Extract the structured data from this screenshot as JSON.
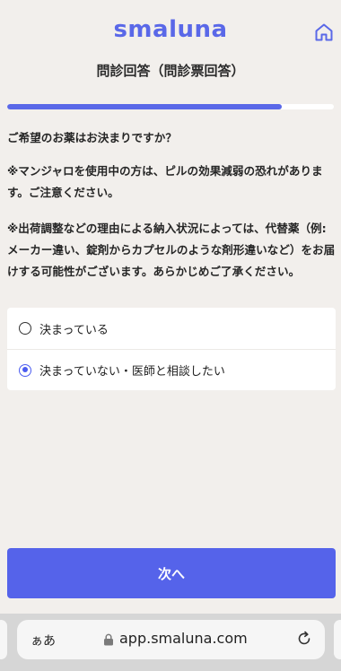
{
  "header": {
    "logo_text": "smaluna",
    "home_icon": "home-icon"
  },
  "page": {
    "title": "問診回答（問診票回答）"
  },
  "progress": {
    "fraction": 0.84
  },
  "question": {
    "text": "ご希望のお薬はお決まりですか？",
    "note1": "※マンジャロを使用中の方は、ピルの効果減弱の恐れがあります。ご注意ください。",
    "note2": "※出荷調整などの理由による納入状況によっては、代替薬（例:メーカー違い、錠剤からカプセルのような剤形違いなど）をお届けする可能性がございます。あらかじめご了承ください。"
  },
  "options": [
    {
      "label": "決まっている",
      "selected": false
    },
    {
      "label": "決まっていない・医師と相談したい",
      "selected": true
    }
  ],
  "next_button": {
    "label": "次へ"
  },
  "browser": {
    "text_size_label": "ぁあ",
    "url": "app.smaluna.com",
    "lock_icon": "lock-icon",
    "reload_icon": "reload-icon"
  },
  "colors": {
    "brand": "#5a68e8",
    "background": "#f2efec",
    "button": "#5563ea"
  }
}
